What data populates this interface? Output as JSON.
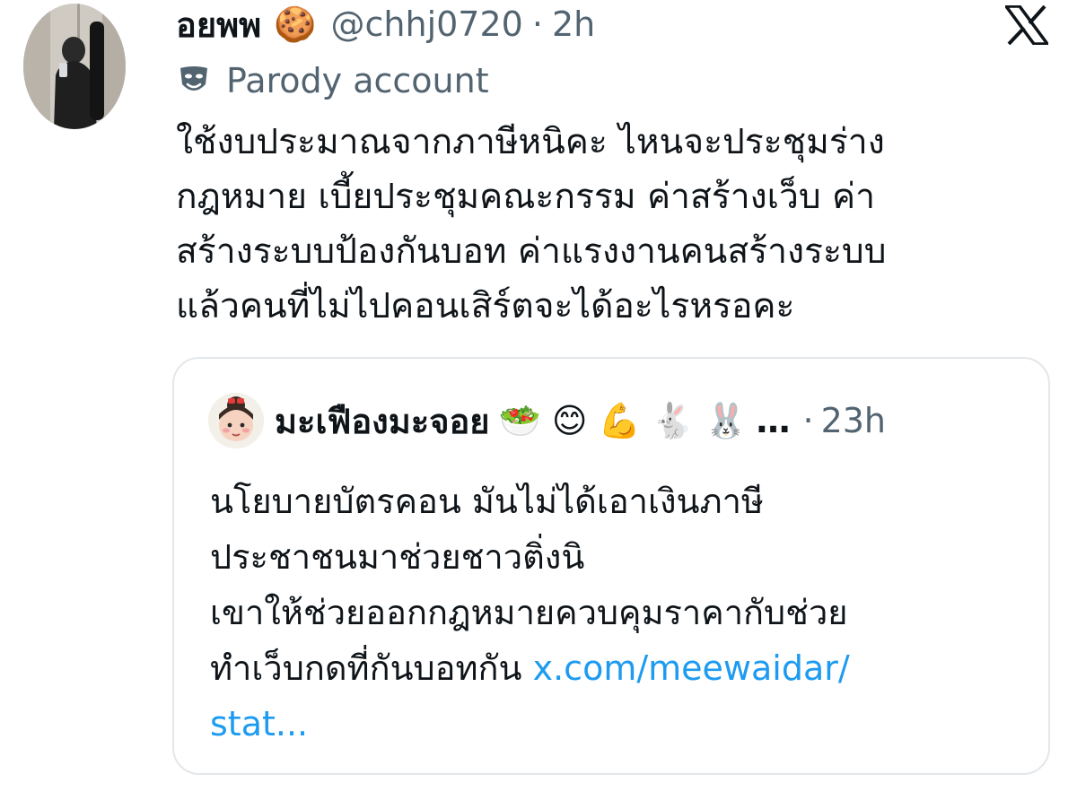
{
  "tweet": {
    "author": {
      "display_name": "อยพพ",
      "name_emoji": "🍪",
      "handle": "@chhj0720",
      "separator": "·",
      "time": "2h",
      "avatar": "profile-photo"
    },
    "label": {
      "icon": "parody-mask-icon",
      "text": "Parody account"
    },
    "body_lines": [
      "ใช้งบประมาณจากภาษีหนิคะ ไหนจะประชุมร่าง",
      "กฎหมาย เบี้ยประชุมคณะกรรม ค่าสร้างเว็บ ค่า",
      "สร้างระบบป้องกันบอท ค่าแรงงานคนสร้างระบบ",
      "แล้วคนที่ไม่ไปคอนเสิร์ตจะได้อะไรหรอคะ"
    ]
  },
  "quote": {
    "author": {
      "display_name": "มะเฟืองมะจอย",
      "emojis": [
        "🥗",
        "😊",
        "💪",
        "🐇",
        "🐰"
      ],
      "ellipsis": "…",
      "separator": "·",
      "time": "23h"
    },
    "lines": [
      "นโยบายบัตรคอน มันไม่ได้เอาเงินภาษี",
      "ประชาชนมาช่วยชาวติ่งนิ",
      "เขาให้ช่วยออกกฎหมายควบคุมราคากับช่วย"
    ],
    "last_line_text": "ทำเว็บกดที่กันบอทกัน ",
    "link_part1": "x.com/meewaidar/",
    "link_part2": "stat..."
  },
  "branding": {
    "logo": "x-logo-icon"
  },
  "colors": {
    "text_primary": "#0f1419",
    "text_secondary": "#536471",
    "link": "#1d9bf0",
    "border": "#e3e7ea"
  }
}
